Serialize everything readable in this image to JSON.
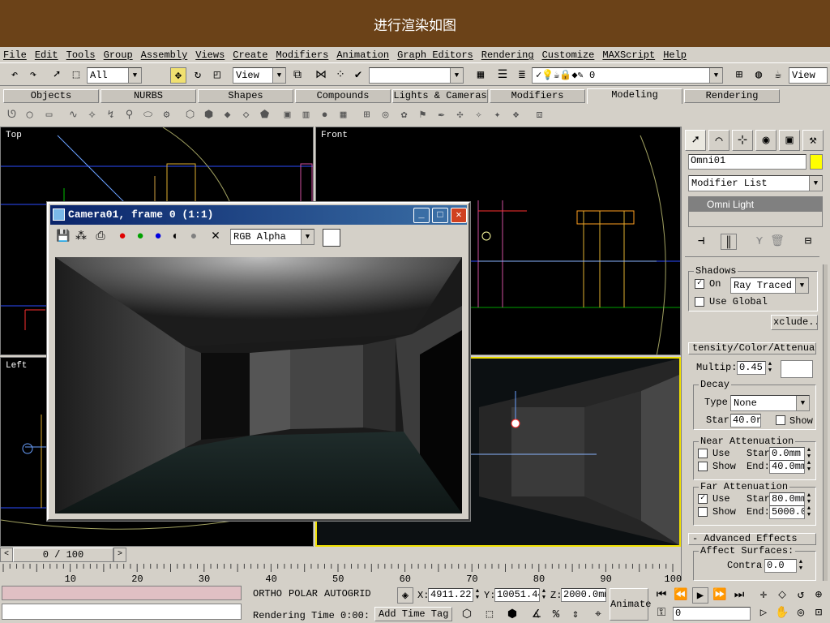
{
  "banner": {
    "title": "进行渲染如图"
  },
  "menu": [
    "File",
    "Edit",
    "Tools",
    "Group",
    "Assembly",
    "Views",
    "Create",
    "Modifiers",
    "Animation",
    "Graph Editors",
    "Rendering",
    "Customize",
    "MAXScript",
    "Help"
  ],
  "toolbar": {
    "selection_filter": "All",
    "ref_coord": "View",
    "named_selection": "",
    "layer": "0",
    "render_type": "View"
  },
  "tabs": [
    {
      "label": "Objects",
      "active": false
    },
    {
      "label": "NURBS",
      "active": false
    },
    {
      "label": "Shapes",
      "active": false
    },
    {
      "label": "Compounds",
      "active": false
    },
    {
      "label": "Lights & Cameras",
      "active": false
    },
    {
      "label": "Modifiers",
      "active": false
    },
    {
      "label": "Modeling",
      "active": true
    },
    {
      "label": "Rendering",
      "active": false
    }
  ],
  "viewports": {
    "top": "Top",
    "front": "Front",
    "left": "Left"
  },
  "vfb": {
    "title": "Camera01, frame 0 (1:1)",
    "channel": "RGB Alpha",
    "colors": {
      "titlebar": "#0a246a",
      "red": "#e00000",
      "green": "#00a000",
      "blue": "#0000e0"
    }
  },
  "panel": {
    "object_name": "Omni01",
    "object_color": "#ffff00",
    "modifier_list": "Modifier List",
    "stack_item": "Omni Light",
    "shadows": {
      "title": "Shadows",
      "on_label": "On",
      "on_checked": true,
      "type": "Ray Traced",
      "use_global": "Use Global",
      "exclude": "xclude.."
    },
    "intensity": {
      "rollout": "tensity/Color/Attenuati",
      "multiplier_label": "Multip:",
      "multiplier": "0.45"
    },
    "decay": {
      "title": "Decay",
      "type_label": "Type",
      "type": "None",
      "start_label": "Star",
      "start": "40.0r",
      "show": "Show"
    },
    "near": {
      "title": "Near Attenuation",
      "use": "Use",
      "show": "Show",
      "start_label": "Star",
      "start": "0.0mm",
      "end_label": "End:",
      "end": "40.0mm"
    },
    "far": {
      "title": "Far Attenuation",
      "use": "Use",
      "use_checked": true,
      "show": "Show",
      "start_label": "Star",
      "start": "80.0mm",
      "end_label": "End:",
      "end": "5000.0"
    },
    "advanced": {
      "rollout": "Advanced Effects",
      "affect": "Affect Surfaces:",
      "contrast_label": "Contra:",
      "contrast": "0.0"
    }
  },
  "timeline": {
    "frame": "0 / 100",
    "ticks": [
      "10",
      "20",
      "30",
      "40",
      "50",
      "60",
      "70",
      "80",
      "90",
      "100"
    ]
  },
  "status": {
    "ortho": "ORTHO",
    "polar": "POLAR",
    "autogrid": "AUTOGRID",
    "x_label": "X:",
    "x": "4911.22",
    "y_label": "Y:",
    "y": "10051.44",
    "z_label": "Z:",
    "z": "2000.0mm",
    "rendering_time": "Rendering Time  0:00:",
    "add_time_tag": "Add Time Tag",
    "animate": "Animate",
    "frame": "0"
  }
}
